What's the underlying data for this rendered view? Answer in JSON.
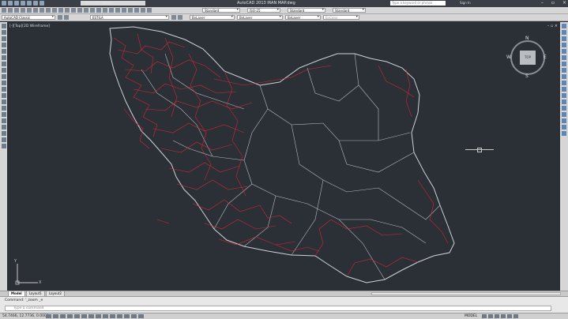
{
  "app": {
    "title": "AutoCAD 2013   IRAN MAP.dwg",
    "workspace": "AutoCAD Classic",
    "search_placeholder": "Type a keyword or phrase",
    "sign_in": "Sign In"
  },
  "toolbar1": {
    "text_style": "Standard",
    "dim_style": "ISO-25",
    "table_style": "Standard",
    "mleader_style": "Standard"
  },
  "toolbar2": {
    "workspace_dropdown": "AutoCAD Classic",
    "layer": "ESTILA",
    "color": "ByLayer",
    "linetype": "ByLayer",
    "lineweight": "ByLayer",
    "plot_style": "ByColor"
  },
  "viewport": {
    "label": "[-][Top][2D Wireframe]",
    "controls": "– ▫ ×",
    "viewcube": {
      "face": "TOP",
      "north": "N",
      "south": "S",
      "east": "E",
      "west": "W"
    },
    "ucs": {
      "x": "X",
      "y": "Y"
    }
  },
  "tabs": {
    "model": "Model",
    "layout1": "Layout1",
    "layout2": "Layout2"
  },
  "command": {
    "history": "Command:  '_zoom _e",
    "prompt": "Type a command"
  },
  "status": {
    "coords": "54.7466, 12.7736, 0.0000",
    "model": "MODEL"
  },
  "colors": {
    "background": "#2b2f36",
    "border_lines": "#cfd3d8",
    "road_lines": "#e0283a"
  }
}
